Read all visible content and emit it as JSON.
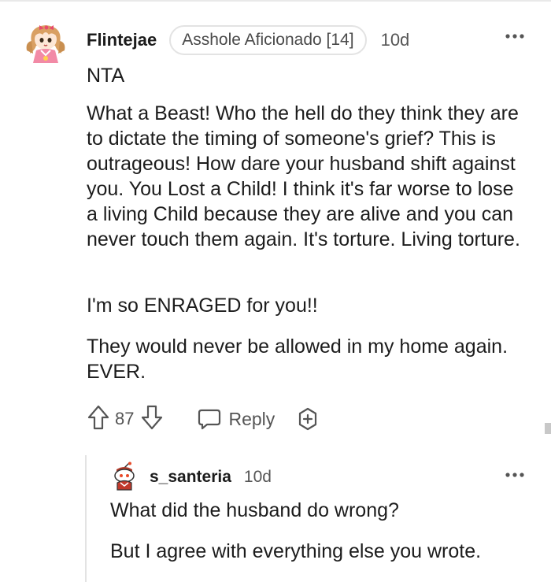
{
  "comment": {
    "username": "Flintejae",
    "flair": "Asshole Aficionado [14]",
    "timestamp": "10d",
    "paragraphs": [
      "NTA",
      "What a Beast! Who the hell do they think they are to dictate the timing of someone's grief? This is outrageous! How dare your husband shift against you. You Lost a Child! I think it's far worse to lose a living Child because they are alive and you can never touch them again. It's torture. Living torture.",
      "I'm so ENRAGED for you!!",
      "They would never be allowed in my home again. EVER."
    ],
    "vote_count": "87",
    "reply_label": "Reply",
    "icons": {
      "avatar": "anime-girl-avatar",
      "more": "more-options-icon",
      "upvote": "upvote-arrow-icon",
      "downvote": "downvote-arrow-icon",
      "reply": "speech-bubble-icon",
      "award": "award-plus-icon"
    }
  },
  "reply": {
    "username": "s_santeria",
    "timestamp": "10d",
    "paragraphs": [
      "What did the husband do wrong?",
      "But I agree with everything else you wrote."
    ],
    "icons": {
      "avatar": "snoo-avatar",
      "more": "more-options-icon"
    }
  },
  "colors": {
    "text": "#1c1c1c",
    "meta": "#555555",
    "border": "#e3e3e3"
  }
}
